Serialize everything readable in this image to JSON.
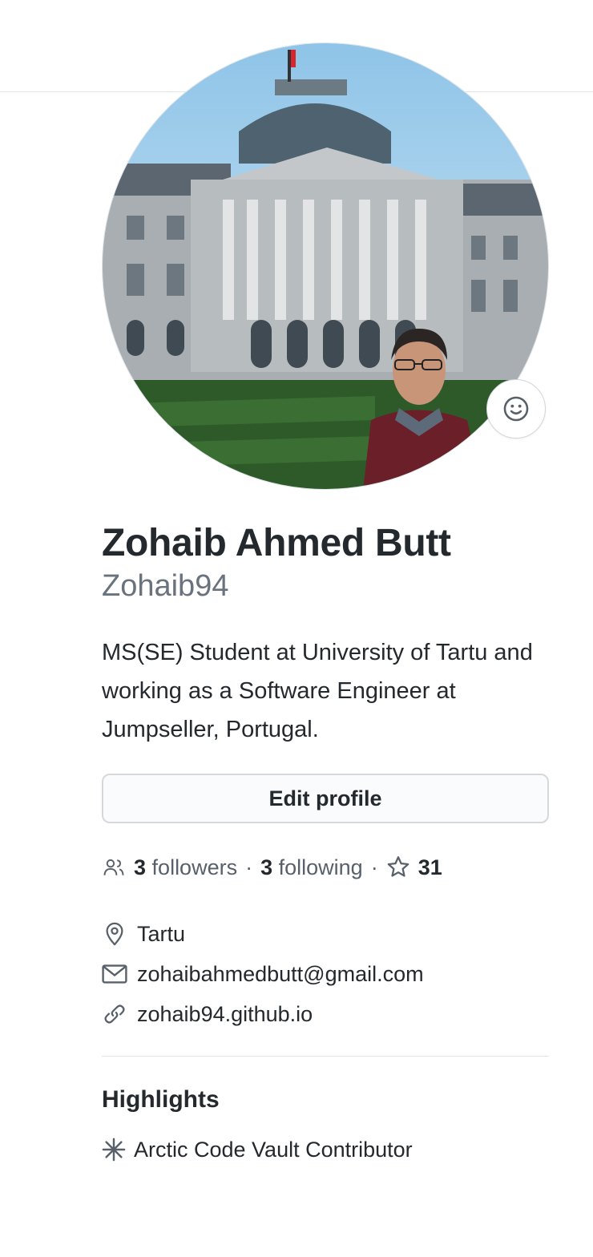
{
  "profile": {
    "full_name": "Zohaib Ahmed Butt",
    "username": "Zohaib94",
    "bio": "MS(SE) Student at University of Tartu and working as a Software Engineer at Jumpseller, Portugal.",
    "avatar_icon": "profile-photo",
    "status_icon": "smiley-icon"
  },
  "actions": {
    "edit_profile_label": "Edit profile"
  },
  "stats": {
    "followers_count": "3",
    "followers_label": "followers",
    "following_count": "3",
    "following_label": "following",
    "separator": "·",
    "stars_count": "31"
  },
  "details": {
    "location": "Tartu",
    "email": "zohaibahmedbutt@gmail.com",
    "website": "zohaib94.github.io"
  },
  "highlights": {
    "title": "Highlights",
    "items": [
      {
        "label": "Arctic Code Vault Contributor",
        "icon": "asterisk-icon"
      }
    ]
  },
  "colors": {
    "text_primary": "#24292e",
    "text_muted": "#586069",
    "username_gray": "#6a737d",
    "border": "#e1e4e8",
    "button_bg": "#fafbfc"
  }
}
